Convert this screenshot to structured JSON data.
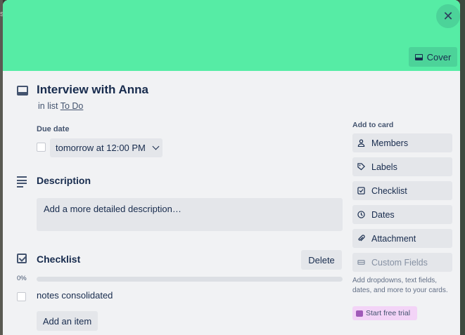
{
  "backdrop": {
    "glyph": "s"
  },
  "modal": {
    "cover_color": "#56eca5",
    "close_glyph": "✕",
    "cover_button_label": "Cover",
    "title": "Interview with Anna",
    "in_list_prefix": "in list",
    "list_name": "To Do"
  },
  "due_date": {
    "label": "Due date",
    "value": "tomorrow at 12:00 PM",
    "checked": false
  },
  "description": {
    "title": "Description",
    "placeholder": "Add a more detailed description…"
  },
  "checklist": {
    "title": "Checklist",
    "delete_label": "Delete",
    "percent_label": "0%",
    "progress": 0,
    "items": [
      {
        "text": "notes consolidated",
        "checked": false
      }
    ],
    "add_item_label": "Add an item"
  },
  "sidebar": {
    "heading": "Add to card",
    "buttons": [
      {
        "label": "Members",
        "icon": "person-icon",
        "disabled": false
      },
      {
        "label": "Labels",
        "icon": "tag-icon",
        "disabled": false
      },
      {
        "label": "Checklist",
        "icon": "checkbox-icon",
        "disabled": false
      },
      {
        "label": "Dates",
        "icon": "clock-icon",
        "disabled": false
      },
      {
        "label": "Attachment",
        "icon": "paperclip-icon",
        "disabled": false
      },
      {
        "label": "Custom Fields",
        "icon": "custom-fields-icon",
        "disabled": true
      }
    ],
    "note": "Add dropdowns, text fields, dates, and more to your cards.",
    "trial_label": "Start free trial"
  },
  "colors": {
    "accent": "#579dff",
    "trial_bg": "#f3d4f7"
  }
}
